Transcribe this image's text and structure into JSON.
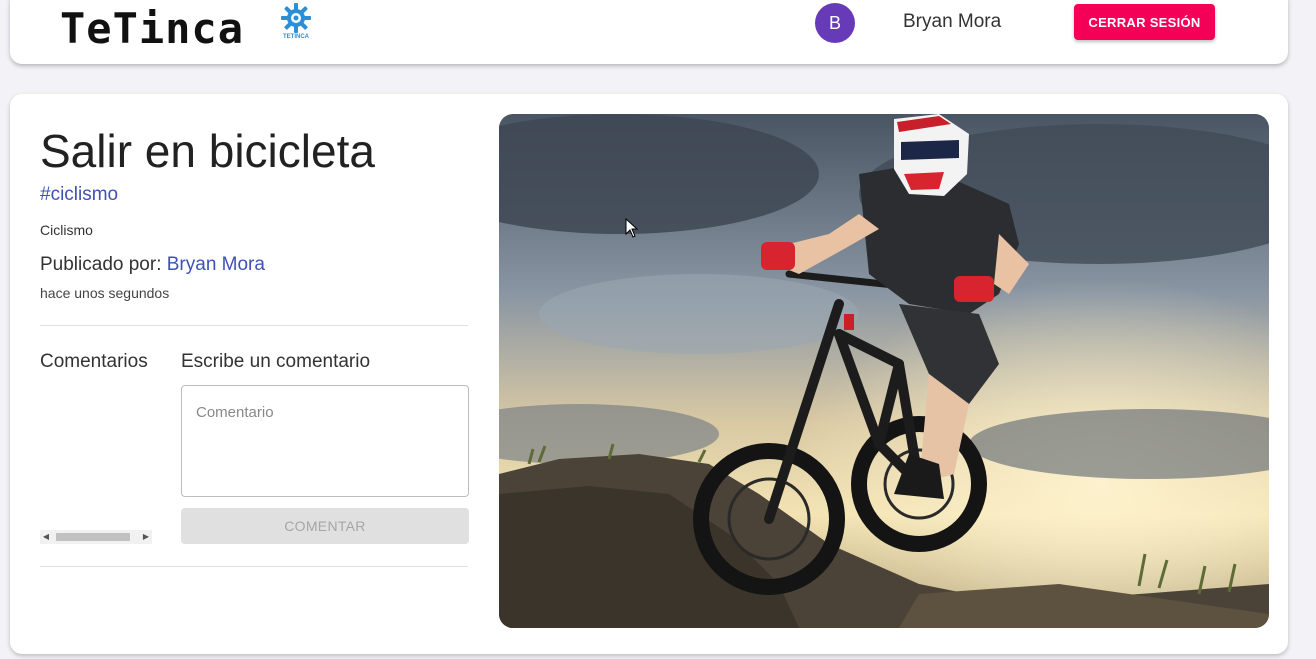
{
  "header": {
    "logo_text": "TeTinca",
    "logo_caption": "TETINCA",
    "user_initial": "B",
    "user_name": "Bryan Mora",
    "logout_label": "CERRAR SESIÓN",
    "logout_color": "#f50057",
    "avatar_color": "#673ab7"
  },
  "post": {
    "title": "Salir en bicicleta",
    "hashtag": "#ciclismo",
    "category": "Ciclismo",
    "published_prefix": "Publicado por:",
    "author": "Bryan Mora",
    "time_ago": "hace unos segundos",
    "image_icon": "mountain-biker-photo"
  },
  "comments": {
    "heading": "Comentarios",
    "write_heading": "Escribe un comentario",
    "placeholder": "Comentario",
    "value": "",
    "submit_label": "COMENTAR"
  },
  "colors": {
    "link": "#3f51b5",
    "background": "#f2f2f7"
  }
}
